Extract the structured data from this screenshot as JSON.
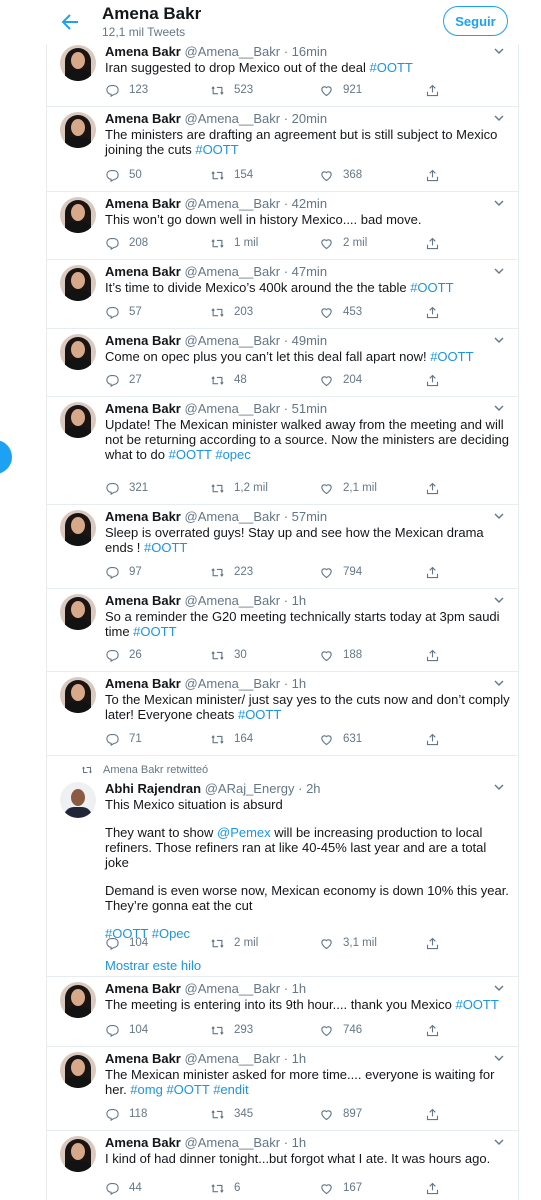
{
  "header": {
    "title": "Amena Bakr",
    "subtitle": "12,1 mil Tweets",
    "follow_label": "Seguir"
  },
  "tweets": [
    {
      "name": "Amena Bakr",
      "handle": "@Amena__Bakr",
      "time": "16min",
      "lines": [
        {
          "segments": [
            {
              "t": "Iran suggested to drop Mexico out of the deal "
            },
            {
              "t": "#OOTT",
              "hl": true
            }
          ]
        }
      ],
      "replies": "123",
      "retweets": "523",
      "likes": "921"
    },
    {
      "name": "Amena Bakr",
      "handle": "@Amena__Bakr",
      "time": "20min",
      "lines": [
        {
          "segments": [
            {
              "t": "The ministers are drafting an agreement but is still subject to Mexico joining the cuts "
            },
            {
              "t": "#OOTT",
              "hl": true
            }
          ]
        }
      ],
      "replies": "50",
      "retweets": "154",
      "likes": "368"
    },
    {
      "name": "Amena Bakr",
      "handle": "@Amena__Bakr",
      "time": "42min",
      "lines": [
        {
          "segments": [
            {
              "t": "This won’t go down well in history Mexico.... bad move."
            }
          ]
        }
      ],
      "replies": "208",
      "retweets": "1 mil",
      "likes": "2 mil"
    },
    {
      "name": "Amena Bakr",
      "handle": "@Amena__Bakr",
      "time": "47min",
      "lines": [
        {
          "segments": [
            {
              "t": "It’s time to divide Mexico’s 400k around the the table "
            },
            {
              "t": "#OOTT",
              "hl": true
            }
          ]
        }
      ],
      "replies": "57",
      "retweets": "203",
      "likes": "453"
    },
    {
      "name": "Amena Bakr",
      "handle": "@Amena__Bakr",
      "time": "49min",
      "lines": [
        {
          "segments": [
            {
              "t": "Come on opec plus you can’t let this deal fall apart now! "
            },
            {
              "t": "#OOTT",
              "hl": true
            }
          ]
        }
      ],
      "replies": "27",
      "retweets": "48",
      "likes": "204"
    },
    {
      "name": "Amena Bakr",
      "handle": "@Amena__Bakr",
      "time": "51min",
      "lines": [
        {
          "segments": [
            {
              "t": "Update! The Mexican minister walked away from the meeting and will not be returning according to a source. Now the ministers are deciding what to do "
            },
            {
              "t": "#OOTT",
              "hl": true
            },
            {
              "t": " "
            },
            {
              "t": "#opec",
              "hl": true
            }
          ]
        }
      ],
      "replies": "321",
      "retweets": "1,2 mil",
      "likes": "2,1 mil"
    },
    {
      "name": "Amena Bakr",
      "handle": "@Amena__Bakr",
      "time": "57min",
      "lines": [
        {
          "segments": [
            {
              "t": "Sleep is overrated guys! Stay up and see how the Mexican drama ends ! "
            },
            {
              "t": "#OOTT",
              "hl": true
            }
          ]
        }
      ],
      "replies": "97",
      "retweets": "223",
      "likes": "794"
    },
    {
      "name": "Amena Bakr",
      "handle": "@Amena__Bakr",
      "time": "1h",
      "lines": [
        {
          "segments": [
            {
              "t": "So a reminder the G20 meeting technically starts today at 3pm saudi time "
            },
            {
              "t": "#OOTT",
              "hl": true
            }
          ]
        }
      ],
      "replies": "26",
      "retweets": "30",
      "likes": "188"
    },
    {
      "name": "Amena Bakr",
      "handle": "@Amena__Bakr",
      "time": "1h",
      "lines": [
        {
          "segments": [
            {
              "t": "To the Mexican minister/ just say yes to the cuts now and don’t comply later! Everyone cheats "
            },
            {
              "t": "#OOTT",
              "hl": true
            }
          ]
        }
      ],
      "replies": "71",
      "retweets": "164",
      "likes": "631"
    },
    {
      "retweet_context": "Amena Bakr retwitteó",
      "name": "Abhi Rajendran",
      "handle": "@ARaj_Energy",
      "time": "2h",
      "lines": [
        {
          "segments": [
            {
              "t": "This Mexico situation is absurd"
            }
          ]
        },
        {
          "segments": [
            {
              "t": "They want to show "
            },
            {
              "t": "@Pemex",
              "hl": true
            },
            {
              "t": " will be increasing production to local refiners. Those refiners ran at like 40-45% last year and are a total joke"
            }
          ]
        },
        {
          "segments": [
            {
              "t": "Demand is even worse now, Mexican economy is down 10% this year. They’re gonna eat the cut"
            }
          ]
        },
        {
          "segments": [
            {
              "t": "#OOTT",
              "hl": true
            },
            {
              "t": " "
            },
            {
              "t": "#Opec",
              "hl": true
            }
          ]
        }
      ],
      "replies": "104",
      "retweets": "2 mil",
      "likes": "3,1 mil",
      "thread_link": "Mostrar este hilo"
    },
    {
      "name": "Amena Bakr",
      "handle": "@Amena__Bakr",
      "time": "1h",
      "lines": [
        {
          "segments": [
            {
              "t": "The meeting is entering into its 9th hour.... thank you Mexico "
            },
            {
              "t": "#OOTT",
              "hl": true
            }
          ]
        }
      ],
      "replies": "104",
      "retweets": "293",
      "likes": "746"
    },
    {
      "name": "Amena Bakr",
      "handle": "@Amena__Bakr",
      "time": "1h",
      "lines": [
        {
          "segments": [
            {
              "t": "The Mexican minister asked for more time.... everyone is waiting for her. "
            },
            {
              "t": "#omg",
              "hl": true
            },
            {
              "t": " "
            },
            {
              "t": "#OOTT",
              "hl": true
            },
            {
              "t": " "
            },
            {
              "t": "#endit",
              "hl": true
            }
          ]
        }
      ],
      "replies": "118",
      "retweets": "345",
      "likes": "897"
    },
    {
      "name": "Amena Bakr",
      "handle": "@Amena__Bakr",
      "time": "1h",
      "lines": [
        {
          "segments": [
            {
              "t": "I kind of had dinner tonight...but forgot what I ate. It was hours ago."
            }
          ]
        }
      ],
      "replies": "44",
      "retweets": "6",
      "likes": "167"
    }
  ]
}
